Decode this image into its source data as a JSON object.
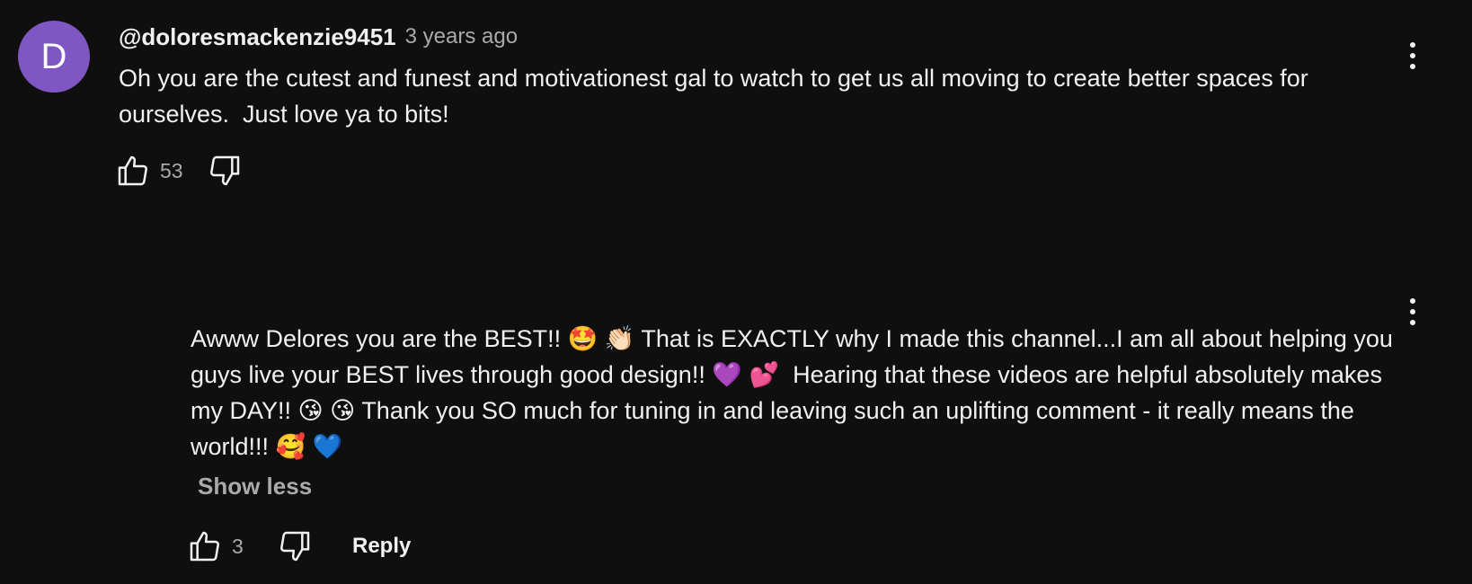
{
  "comment": {
    "avatar_letter": "D",
    "avatar_color": "#7e57c2",
    "author": "@doloresmackenzie9451",
    "timestamp": "3 years ago",
    "text": "Oh you are the cutest and funest and motivationest gal to watch to get us all moving to create better spaces for ourselves.  Just love ya to bits!",
    "like_count": "53",
    "icons": {
      "like": "thumbs-up-icon",
      "dislike": "thumbs-down-icon",
      "more": "more-vertical-icon"
    }
  },
  "reply": {
    "text": "Awww Delores you are the BEST!! 🤩 👏🏻 That is EXACTLY why I made this channel...I am all about helping you guys live your BEST lives through good design!! 💜 💕  Hearing that these videos are helpful absolutely makes my DAY!! 😘 😘 Thank you SO much for tuning in and leaving such an uplifting comment - it really means the world!!! 🥰 💙",
    "show_less_label": "Show less",
    "like_count": "3",
    "reply_label": "Reply",
    "icons": {
      "like": "thumbs-up-icon",
      "dislike": "thumbs-down-icon",
      "more": "more-vertical-icon"
    }
  },
  "colors": {
    "background": "#0f0f0f",
    "primary_text": "#f1f1f1",
    "secondary_text": "#aaaaaa"
  }
}
